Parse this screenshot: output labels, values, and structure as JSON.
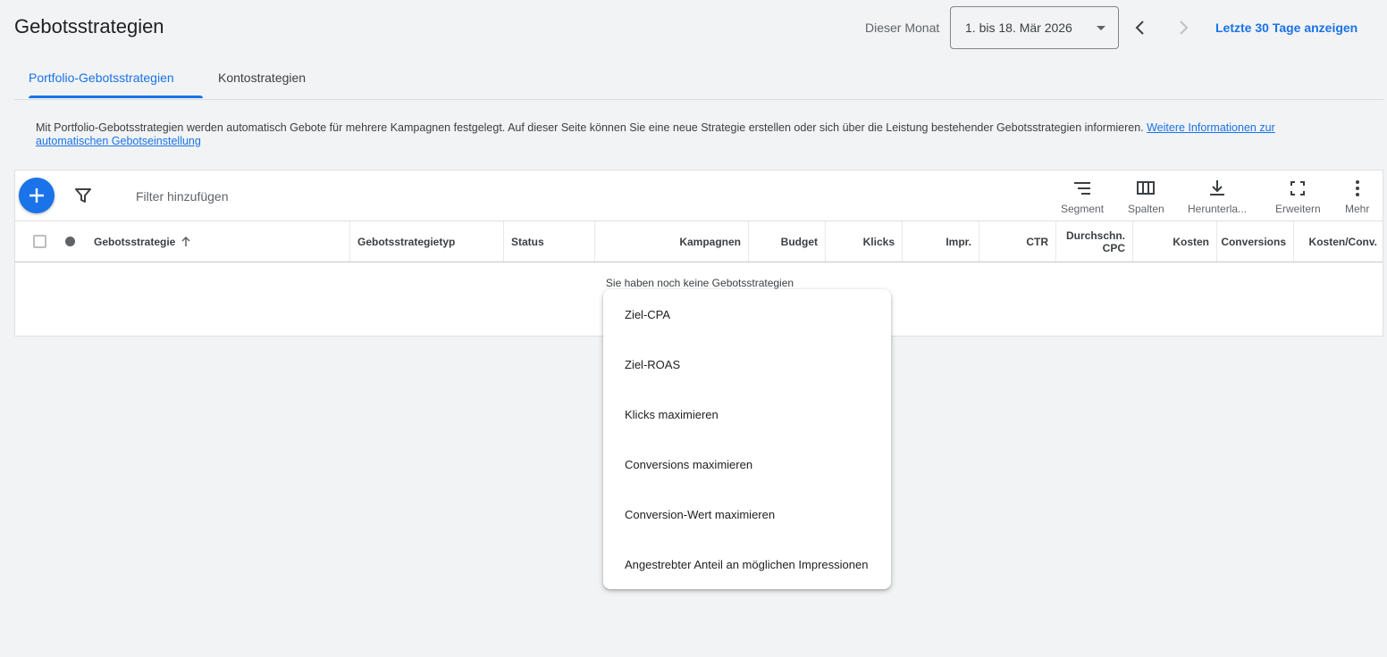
{
  "header": {
    "title": "Gebotsstrategien",
    "date_label": "Dieser Monat",
    "date_range": "1. bis 18. Mär 2026",
    "last30_link": "Letzte 30 Tage anzeigen"
  },
  "tabs": [
    {
      "label": "Portfolio-Gebotsstrategien",
      "active": true
    },
    {
      "label": "Kontostrategien",
      "active": false
    }
  ],
  "info": {
    "text": "Mit Portfolio-Gebotsstrategien werden automatisch Gebote für mehrere Kampagnen festgelegt. Auf dieser Seite können Sie eine neue Strategie erstellen oder sich über die Leistung bestehender Gebotsstrategien informieren. ",
    "link": "Weitere Informationen zur automatischen Gebotseinstellung"
  },
  "toolbar": {
    "filter_placeholder": "Filter hinzufügen",
    "tools": [
      {
        "label": "Segment",
        "icon": "segment-icon"
      },
      {
        "label": "Spalten",
        "icon": "columns-icon"
      },
      {
        "label": "Herunterla...",
        "icon": "download-icon"
      },
      {
        "label": "Erweitern",
        "icon": "fullscreen-icon"
      },
      {
        "label": "Mehr",
        "icon": "more-vert-icon"
      }
    ]
  },
  "table": {
    "columns": [
      "Gebotsstrategie",
      "Gebotsstrategietyp",
      "Status",
      "Kampagnen",
      "Budget",
      "Klicks",
      "Impr.",
      "CTR",
      "Durchschn. CPC",
      "Kosten",
      "Conversions",
      "Kosten/Conv."
    ],
    "empty_message": "Sie haben noch keine Gebotsstrategien"
  },
  "menu": {
    "items": [
      "Ziel-CPA",
      "Ziel-ROAS",
      "Klicks maximieren",
      "Conversions maximieren",
      "Conversion-Wert maximieren",
      "Angestrebter Anteil an möglichen Impressionen"
    ]
  },
  "colors": {
    "accent": "#1a73e8",
    "background": "#f1f3f4"
  }
}
